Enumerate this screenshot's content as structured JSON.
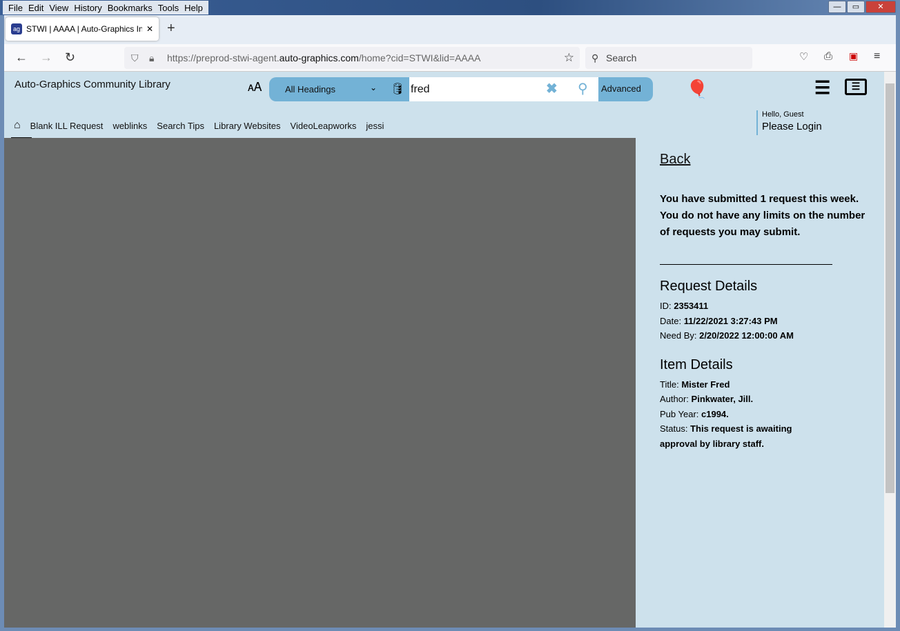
{
  "browser": {
    "menu": [
      "File",
      "Edit",
      "View",
      "History",
      "Bookmarks",
      "Tools",
      "Help"
    ],
    "tab_title": "STWI | AAAA | Auto-Graphics In",
    "url_prefix": "https://preprod-stwi-agent.",
    "url_domain": "auto-graphics.com",
    "url_suffix": "/home?cid=STWI&lid=AAAA",
    "search_placeholder": "Search"
  },
  "header": {
    "library_name": "Auto-Graphics Community Library",
    "search_type": "All Headings",
    "search_value": "fred",
    "advanced_label": "Advanced",
    "nav": [
      "Blank ILL Request",
      "weblinks",
      "Search Tips",
      "Library Websites",
      "VideoLeapworks",
      "jessi"
    ],
    "greeting": "Hello, Guest",
    "login_label": "Please Login"
  },
  "panel": {
    "back_label": "Back",
    "message1": "You have submitted 1 request this week.",
    "message2": "You do not have any limits on the number of requests you may submit.",
    "request_heading": "Request Details",
    "request": [
      {
        "label": "ID: ",
        "value": "2353411"
      },
      {
        "label": "Date: ",
        "value": "11/22/2021 3:27:43 PM"
      },
      {
        "label": "Need By: ",
        "value": "2/20/2022 12:00:00 AM"
      }
    ],
    "item_heading": "Item Details",
    "item": [
      {
        "label": "Title: ",
        "value": "Mister Fred"
      },
      {
        "label": "Author: ",
        "value": "Pinkwater, Jill."
      },
      {
        "label": "Pub Year: ",
        "value": "c1994."
      },
      {
        "label": "Status: ",
        "value": "This request is awaiting approval by library staff."
      }
    ]
  }
}
